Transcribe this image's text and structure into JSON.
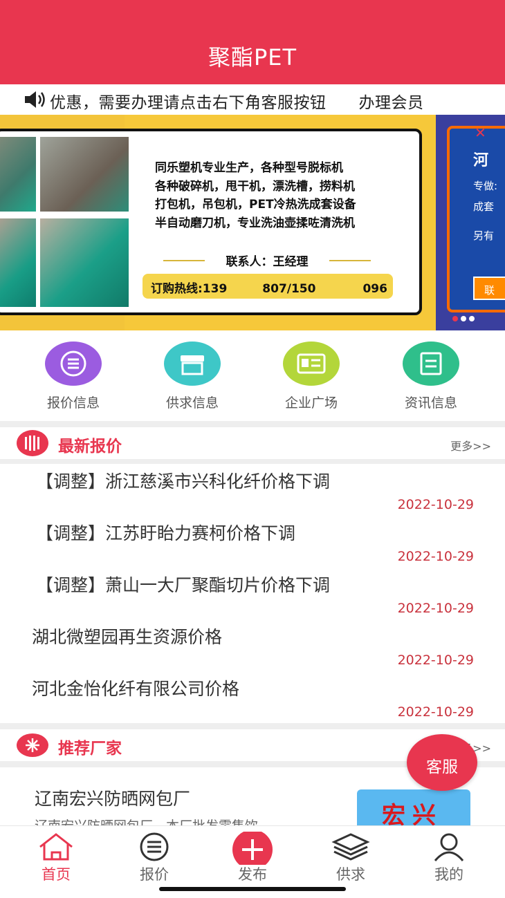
{
  "header": {
    "title": "聚酯PET"
  },
  "notice": {
    "text": "优惠，需要办理请点击右下角客服按钮　　办理会员"
  },
  "banner": {
    "desc_lines": [
      "同乐塑机专业生产，各种型号脱标机",
      "各种破碎机，甩干机，漂洗槽，捞料机",
      "打包机，吊包机，PET冷热洗成套设备",
      "半自动磨刀机，专业洗油壶揉咗清洗机"
    ],
    "contact": "联系人：王经理",
    "hotline": "订购热线:139　　　807/150　　　　096",
    "card2": {
      "title": "河",
      "line1": "专做:",
      "line2": "成套",
      "line3": "另有",
      "button": "联"
    }
  },
  "quicknav": [
    {
      "label": "报价信息",
      "color": "#9b5ce0",
      "icon": "list-icon"
    },
    {
      "label": "供求信息",
      "color": "#3ec7c7",
      "icon": "store-icon"
    },
    {
      "label": "企业广场",
      "color": "#b3d63a",
      "icon": "id-card-icon"
    },
    {
      "label": "资讯信息",
      "color": "#2fbf8b",
      "icon": "document-icon"
    }
  ],
  "latest": {
    "title": "最新报价",
    "more": "更多>>",
    "items": [
      {
        "title": "【调整】浙江慈溪市兴科化纤价格下调",
        "date": "2022-10-29"
      },
      {
        "title": "【调整】江苏盱眙力赛柯价格下调",
        "date": "2022-10-29"
      },
      {
        "title": "【调整】萧山一大厂聚酯切片价格下调",
        "date": "2022-10-29"
      },
      {
        "title": "湖北微塑园再生资源价格",
        "date": "2022-10-29"
      },
      {
        "title": "河北金怡化纤有限公司价格",
        "date": "2022-10-29"
      }
    ]
  },
  "recommend": {
    "title": "推荐厂家",
    "more": "更多>>",
    "factory": {
      "name": "辽南宏兴防晒网包厂",
      "desc": "辽南宏兴防晒网包厂，本厂批发零售饮",
      "logo_text": "宏兴"
    }
  },
  "service_button": "客服",
  "tabbar": [
    {
      "label": "首页",
      "icon": "home-icon",
      "active": true
    },
    {
      "label": "报价",
      "icon": "list-icon",
      "active": false
    },
    {
      "label": "发布",
      "icon": "plus-icon",
      "active": false
    },
    {
      "label": "供求",
      "icon": "layers-icon",
      "active": false
    },
    {
      "label": "我的",
      "icon": "user-icon",
      "active": false
    }
  ],
  "colors": {
    "brand": "#e8364f",
    "date": "#c9323d"
  }
}
